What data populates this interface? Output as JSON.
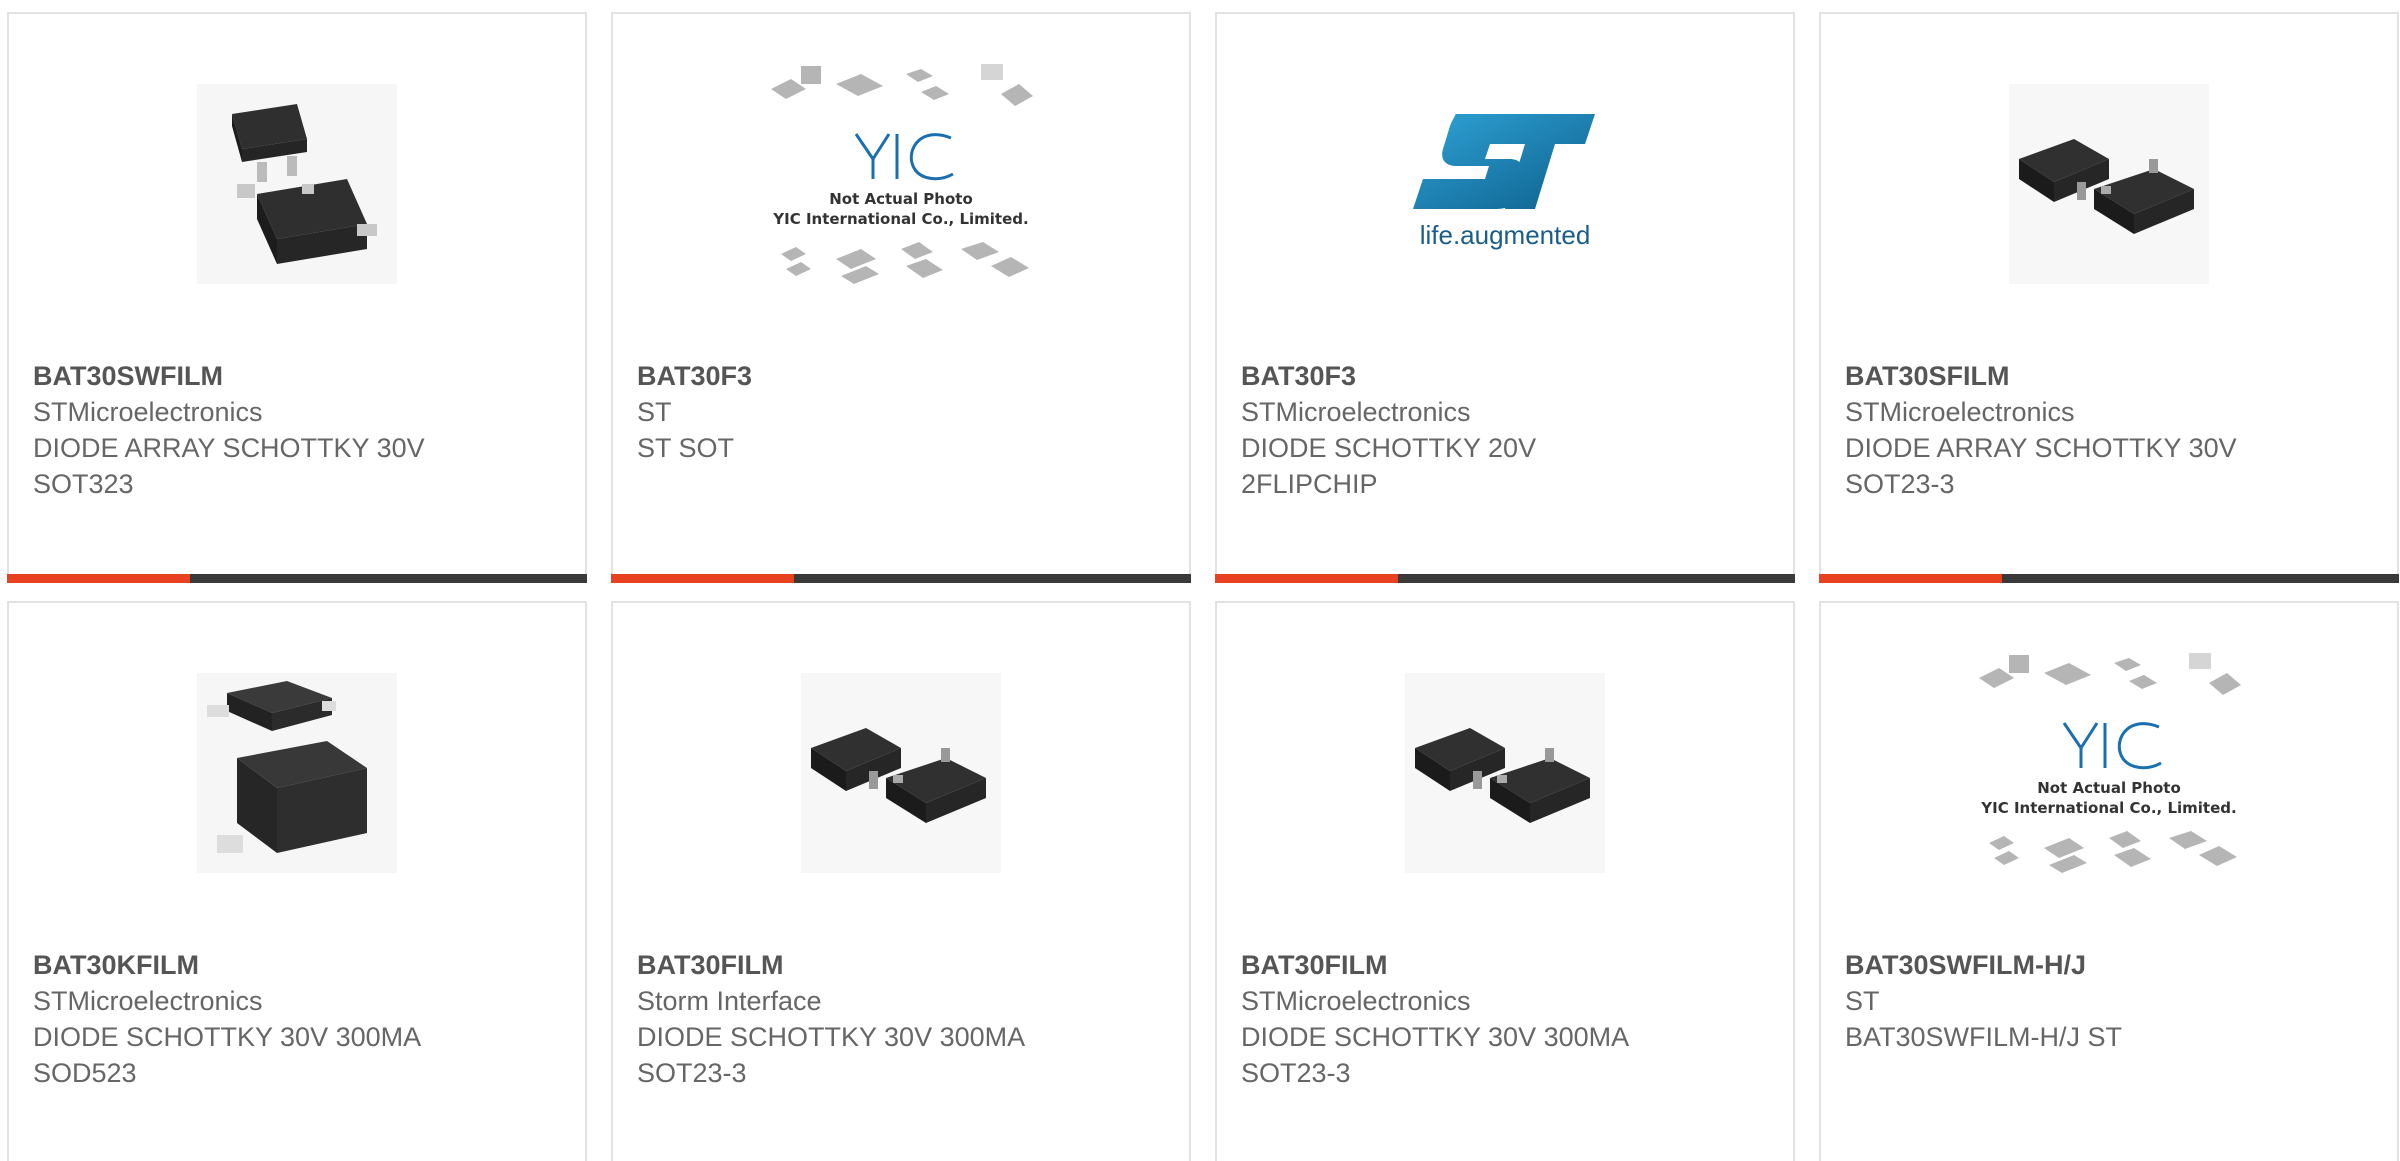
{
  "products": [
    {
      "part": "BAT30SWFILM",
      "maker": "STMicroelectronics",
      "desc1": "DIODE ARRAY SCHOTTKY 30V",
      "desc2": "SOT323",
      "image": "sot323-package"
    },
    {
      "part": "BAT30F3",
      "maker": "ST",
      "desc1": "ST SOT",
      "desc2": "",
      "image": "yic-placeholder"
    },
    {
      "part": "BAT30F3",
      "maker": "STMicroelectronics",
      "desc1": "DIODE SCHOTTKY 20V",
      "desc2": "2FLIPCHIP",
      "image": "st-logo"
    },
    {
      "part": "BAT30SFILM",
      "maker": "STMicroelectronics",
      "desc1": "DIODE ARRAY SCHOTTKY 30V",
      "desc2": "SOT23-3",
      "image": "sot23-package"
    },
    {
      "part": "BAT30KFILM",
      "maker": "STMicroelectronics",
      "desc1": "DIODE SCHOTTKY 30V 300MA",
      "desc2": "SOD523",
      "image": "sod523-package"
    },
    {
      "part": "BAT30FILM",
      "maker": "Storm Interface",
      "desc1": "DIODE SCHOTTKY 30V 300MA",
      "desc2": "SOT23-3",
      "image": "sot23-package"
    },
    {
      "part": "BAT30FILM",
      "maker": "STMicroelectronics",
      "desc1": "DIODE SCHOTTKY 30V 300MA",
      "desc2": "SOT23-3",
      "image": "sot23-package"
    },
    {
      "part": "BAT30SWFILM-H/J",
      "maker": "ST",
      "desc1": "BAT30SWFILM-H/J ST",
      "desc2": "",
      "image": "yic-placeholder"
    }
  ],
  "placeholder": {
    "brand": "YIC",
    "line1": "Not Actual Photo",
    "line2": "YIC International Co., Limited."
  },
  "st_logo": {
    "tagline": "life.augmented"
  },
  "colors": {
    "accent": "#e8411f",
    "bar": "#3a3a3a",
    "border": "#e2e2e2",
    "st_blue": "#1a7bb0"
  }
}
